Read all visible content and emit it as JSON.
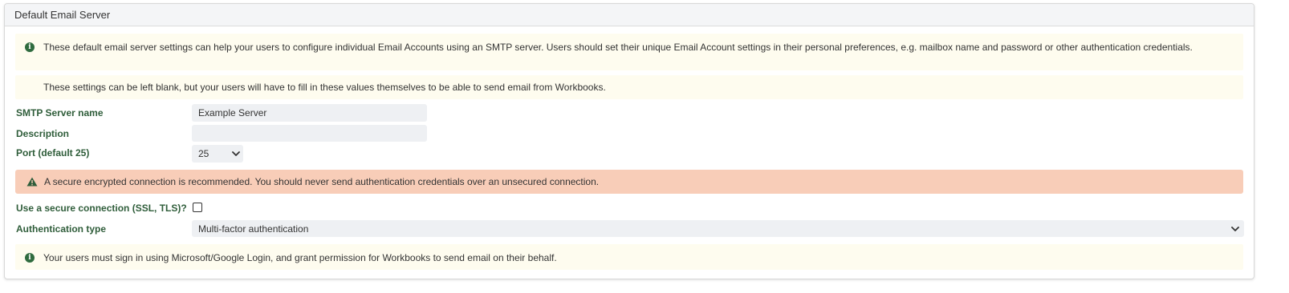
{
  "panel": {
    "title": "Default Email Server"
  },
  "intro_note": {
    "icon": "info-icon",
    "text": "These default email server settings can help your users to configure individual Email Accounts using an SMTP server. Users should set their unique Email Account settings in their personal preferences, e.g. mailbox name and password or other authentication credentials.",
    "text2": "These settings can be left blank, but your users will have to fill in these values themselves to be able to send email from Workbooks."
  },
  "fields": {
    "smtp_server": {
      "label": "SMTP Server name",
      "value": "Example Server"
    },
    "description": {
      "label": "Description",
      "value": ""
    },
    "port": {
      "label": "Port (default 25)",
      "value": "25"
    }
  },
  "warning": {
    "icon": "warning-icon",
    "text": "A secure encrypted connection is recommended. You should never send authentication credentials over an unsecured connection."
  },
  "secure_connection": {
    "label": "Use a secure connection (SSL, TLS)?",
    "checked": false
  },
  "auth_type": {
    "label": "Authentication type",
    "value": "Multi-factor authentication"
  },
  "auth_note": {
    "icon": "info-icon",
    "text": "Your users must sign in using Microsoft/Google Login, and grant permission for Workbooks to send email on their behalf."
  },
  "colors": {
    "label_green": "#2f5d3a",
    "note_bg": "#fefcef",
    "warning_bg": "#f8cdb8",
    "input_bg": "#eef0f3"
  }
}
